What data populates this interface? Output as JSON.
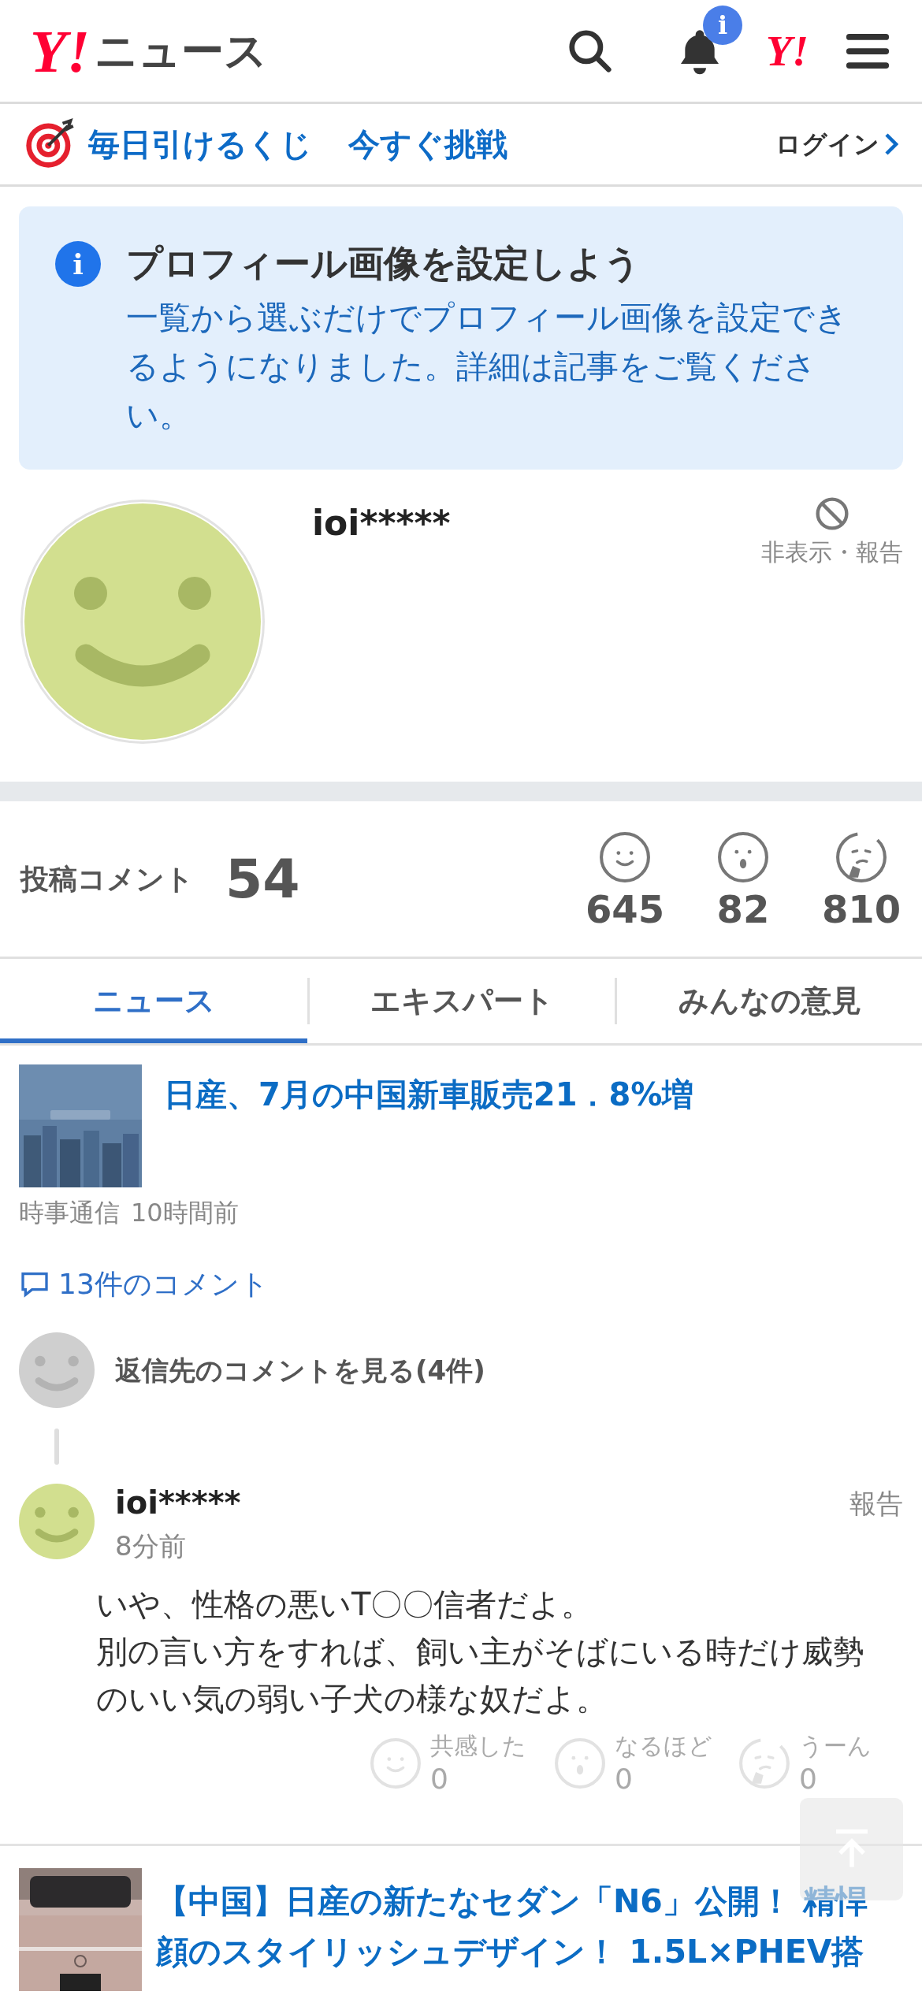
{
  "header": {
    "logo_mark": "Y!",
    "logo_text": "ニュース",
    "notification_badge": "i",
    "account_mark": "Y!"
  },
  "lottery": {
    "title": "毎日引けるくじ",
    "action": "今すぐ挑戦",
    "login": "ログイン"
  },
  "notice": {
    "icon": "i",
    "title": "プロフィール画像を設定しよう",
    "body": "一覧から選ぶだけでプロフィール画像を設定できるようになりました。詳細は記事をご覧ください。"
  },
  "profile": {
    "name": "ioi*****",
    "hide_report": "非表示・報告"
  },
  "stats": {
    "label": "投稿コメント",
    "count": "54",
    "reactions": [
      {
        "kind": "smile",
        "count": "645"
      },
      {
        "kind": "surprise",
        "count": "82"
      },
      {
        "kind": "thinking",
        "count": "810"
      }
    ]
  },
  "tabs": [
    {
      "label": "ニュース",
      "selected": true
    },
    {
      "label": "エキスパート",
      "selected": false
    },
    {
      "label": "みんなの意見",
      "selected": false
    }
  ],
  "articles": [
    {
      "title": "日産、7月の中国新車販売21．8%増",
      "source": "時事通信",
      "time": "10時間前",
      "comments_link": "13件のコメント",
      "reply_link": "返信先のコメントを見る(4件)",
      "comment": {
        "user": "ioi*****",
        "time": "8分前",
        "report": "報告",
        "body": [
          "いや、性格の悪いT〇〇信者だよ。",
          "別の言い方をすれば、飼い主がそばにいる時だけ威勢のいい気の弱い子犬の様な奴だよ。"
        ],
        "reactions": [
          {
            "kind": "smile",
            "label": "共感した",
            "count": "0"
          },
          {
            "kind": "surprise",
            "label": "なるほど",
            "count": "0"
          },
          {
            "kind": "thinking",
            "label": "うーん",
            "count": "0"
          }
        ]
      }
    },
    {
      "title": "【中国】日産の新たなセダン「N6」公開！ 精悍顔のスタイリッシュデザイン！ 1.5L×PHEV搭"
    }
  ]
}
